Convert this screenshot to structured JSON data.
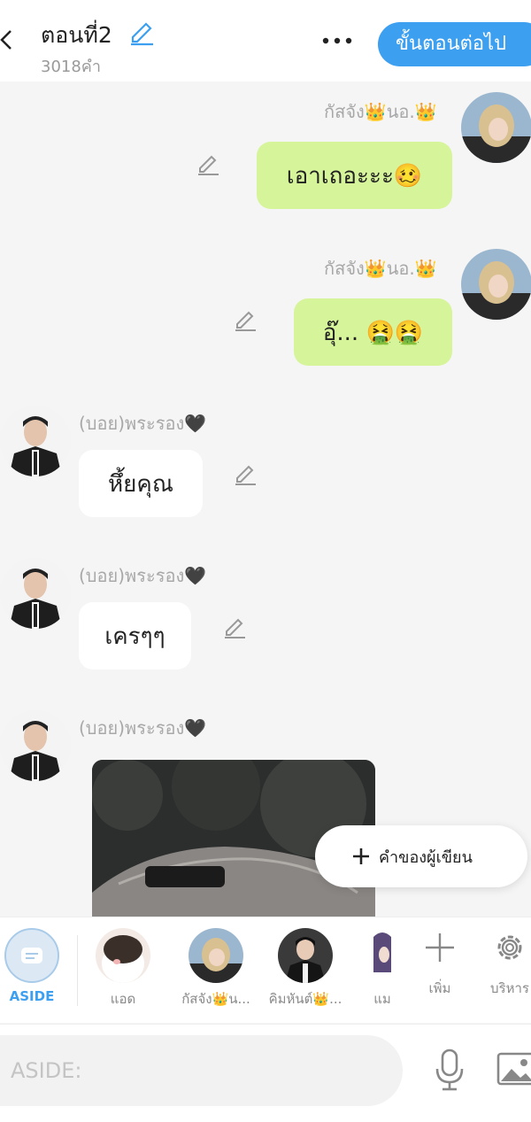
{
  "header": {
    "title": "ตอนที่2",
    "word_count": "3018คำ",
    "next_label": "ขั้นตอนต่อไป"
  },
  "messages": [
    {
      "sender": "กัสจัง👑นอ.👑",
      "text": "เอาเถอะะะ🥴",
      "side": "right"
    },
    {
      "sender": "กัสจัง👑นอ.👑",
      "text": "อุ๊... 🤮🤮",
      "side": "right"
    },
    {
      "sender": "(บอย)พระรอง🖤",
      "text": "หึ้ยคุณ",
      "side": "left"
    },
    {
      "sender": "(บอย)พระรอง🖤",
      "text": "เครๆๆ",
      "side": "left"
    },
    {
      "sender": "(บอย)พระรอง🖤",
      "text": "",
      "side": "left"
    }
  ],
  "fab": {
    "label": "คำของผู้เขียน"
  },
  "characters": [
    {
      "label": "ASIDE"
    },
    {
      "label": "แอด"
    },
    {
      "label": "กัสจัง👑น..."
    },
    {
      "label": "คิมหันต์👑..."
    },
    {
      "label": "แม"
    },
    {
      "label": "เพิ่ม"
    },
    {
      "label": "บริหาร"
    }
  ],
  "input": {
    "placeholder": "ASIDE:"
  },
  "colors": {
    "accent": "#3d9ff0",
    "my_bubble": "#d6f59b",
    "other_bubble": "#ffffff"
  }
}
